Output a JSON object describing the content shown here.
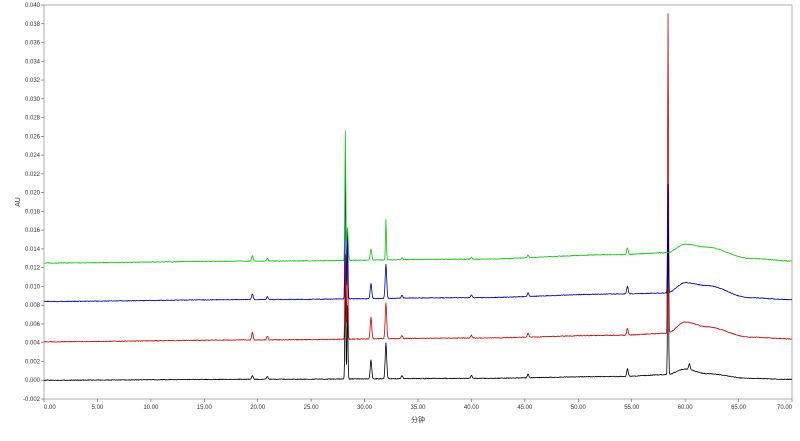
{
  "chart_data": {
    "type": "line",
    "xlabel": "分钟",
    "ylabel": "AU",
    "xlim": [
      0,
      70
    ],
    "ylim": [
      -0.002,
      0.04
    ],
    "grid": false,
    "legend": "none",
    "x_ticks": [
      0,
      5,
      10,
      15,
      20,
      25,
      30,
      35,
      40,
      45,
      50,
      55,
      60,
      65,
      70
    ],
    "x_tick_labels": [
      "0.00",
      "5.00",
      "10.00",
      "15.00",
      "20.00",
      "25.00",
      "30.00",
      "35.00",
      "40.00",
      "45.00",
      "50.00",
      "55.00",
      "60.00",
      "65.00",
      "70.00"
    ],
    "y_ticks": [
      -0.002,
      0,
      0.002,
      0.004,
      0.006,
      0.008,
      0.01,
      0.012,
      0.014,
      0.016,
      0.018,
      0.02,
      0.022,
      0.024,
      0.026,
      0.028,
      0.03,
      0.032,
      0.034,
      0.036,
      0.038,
      0.04
    ],
    "y_tick_labels": [
      "-0.002",
      "0.000",
      "0.002",
      "0.004",
      "0.006",
      "0.008",
      "0.010",
      "0.012",
      "0.014",
      "0.016",
      "0.018",
      "0.020",
      "0.022",
      "0.024",
      "0.026",
      "0.028",
      "0.030",
      "0.032",
      "0.034",
      "0.036",
      "0.038",
      "0.040"
    ],
    "series": [
      {
        "color": "#000000",
        "baseline": [
          [
            0,
            0.0
          ],
          [
            20,
            0.0001
          ],
          [
            40,
            0.0002
          ],
          [
            54,
            0.0004
          ],
          [
            58.3,
            0.0006
          ],
          [
            60,
            0.0012
          ],
          [
            62,
            0.0007
          ],
          [
            66,
            0.0002
          ],
          [
            70,
            0.0001
          ]
        ],
        "peaks": [
          [
            19.5,
            0.0004
          ],
          [
            20.9,
            0.0003
          ],
          [
            28.2,
            0.0108
          ],
          [
            28.4,
            0.0078
          ],
          [
            30.6,
            0.002
          ],
          [
            32.0,
            0.0038
          ],
          [
            33.5,
            0.0003
          ],
          [
            40.0,
            0.0003
          ],
          [
            45.3,
            0.0004
          ],
          [
            54.6,
            0.0008
          ],
          [
            58.4,
            0.0165
          ],
          [
            60.4,
            0.0006
          ]
        ]
      },
      {
        "color": "#cc0000",
        "baseline": [
          [
            0,
            0.0041
          ],
          [
            20,
            0.0043
          ],
          [
            40,
            0.0045
          ],
          [
            54,
            0.0048
          ],
          [
            58.3,
            0.005
          ],
          [
            60,
            0.0062
          ],
          [
            62,
            0.0057
          ],
          [
            66,
            0.0046
          ],
          [
            70,
            0.0044
          ]
        ],
        "peaks": [
          [
            19.5,
            0.0008
          ],
          [
            20.9,
            0.0004
          ],
          [
            28.2,
            0.009
          ],
          [
            28.4,
            0.0105
          ],
          [
            30.6,
            0.0023
          ],
          [
            32.0,
            0.0038
          ],
          [
            33.5,
            0.0003
          ],
          [
            40.0,
            0.0003
          ],
          [
            45.3,
            0.0004
          ],
          [
            54.6,
            0.0007
          ],
          [
            58.4,
            0.0341
          ]
        ]
      },
      {
        "color": "#0000aa",
        "baseline": [
          [
            0,
            0.0084
          ],
          [
            20,
            0.0086
          ],
          [
            40,
            0.0088
          ],
          [
            54,
            0.0092
          ],
          [
            58.3,
            0.0093
          ],
          [
            60,
            0.0104
          ],
          [
            62,
            0.0101
          ],
          [
            66,
            0.0088
          ],
          [
            70,
            0.0086
          ]
        ],
        "peaks": [
          [
            19.5,
            0.0006
          ],
          [
            20.9,
            0.0003
          ],
          [
            28.2,
            0.0139
          ],
          [
            28.4,
            0.0075
          ],
          [
            30.6,
            0.0016
          ],
          [
            32.0,
            0.0036
          ],
          [
            33.5,
            0.0003
          ],
          [
            40.0,
            0.0003
          ],
          [
            45.3,
            0.0004
          ],
          [
            54.6,
            0.0008
          ],
          [
            58.4,
            0.0116
          ]
        ]
      },
      {
        "color": "#00cc00",
        "baseline": [
          [
            0,
            0.0125
          ],
          [
            20,
            0.0127
          ],
          [
            40,
            0.0129
          ],
          [
            54,
            0.0134
          ],
          [
            58.3,
            0.0136
          ],
          [
            60,
            0.0145
          ],
          [
            62,
            0.0142
          ],
          [
            66,
            0.013
          ],
          [
            70,
            0.0127
          ]
        ],
        "peaks": [
          [
            19.5,
            0.0006
          ],
          [
            20.9,
            0.0003
          ],
          [
            28.2,
            0.0137
          ],
          [
            28.4,
            0.0035
          ],
          [
            30.6,
            0.0012
          ],
          [
            32.0,
            0.0043
          ],
          [
            33.5,
            0.0002
          ],
          [
            40.0,
            0.0002
          ],
          [
            45.3,
            0.0003
          ],
          [
            54.6,
            0.0007
          ]
        ]
      }
    ]
  }
}
